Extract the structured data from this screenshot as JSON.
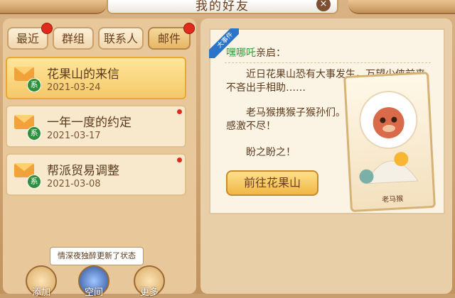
{
  "header": {
    "title": "我的好友",
    "close_label": "×"
  },
  "tabs": [
    {
      "label": "最近",
      "badge": true
    },
    {
      "label": "群组",
      "badge": false
    },
    {
      "label": "联系人",
      "badge": false
    },
    {
      "label": "邮件",
      "badge": true,
      "active": true
    }
  ],
  "mails": [
    {
      "title": "花果山的来信",
      "date": "2021-03-24",
      "badge": "系",
      "selected": true,
      "unread": false
    },
    {
      "title": "一年一度的约定",
      "date": "2021-03-17",
      "badge": "系",
      "unread": true
    },
    {
      "title": "帮派贸易调整",
      "date": "2021-03-08",
      "badge": "系",
      "unread": true
    }
  ],
  "status_tooltip": "情深夜独醉更新了状态",
  "bottom_buttons": [
    {
      "label": "添加",
      "icon": "add-friend-icon"
    },
    {
      "label": "空间",
      "icon": "space-avatar-icon"
    },
    {
      "label": "更多",
      "icon": "more-icon"
    }
  ],
  "letter": {
    "tag": "大事件",
    "recipient": "嘿哪吒",
    "salutation": "亲启：",
    "paragraph1_line1": "近日花果山恐有大事发生，万望少侠前来，",
    "paragraph1_line2": "不吝出手相助……",
    "paragraph2_line1": "老马猴携猴子猴孙们。",
    "paragraph2_line2": "感激不尽！",
    "paragraph3": "盼之盼之！",
    "action_button": "前往花果山",
    "card_caption": "老马猴"
  },
  "colors": {
    "accent": "#f0b746",
    "badge_red": "#e02a1c",
    "system_green": "#2e8f3d"
  }
}
